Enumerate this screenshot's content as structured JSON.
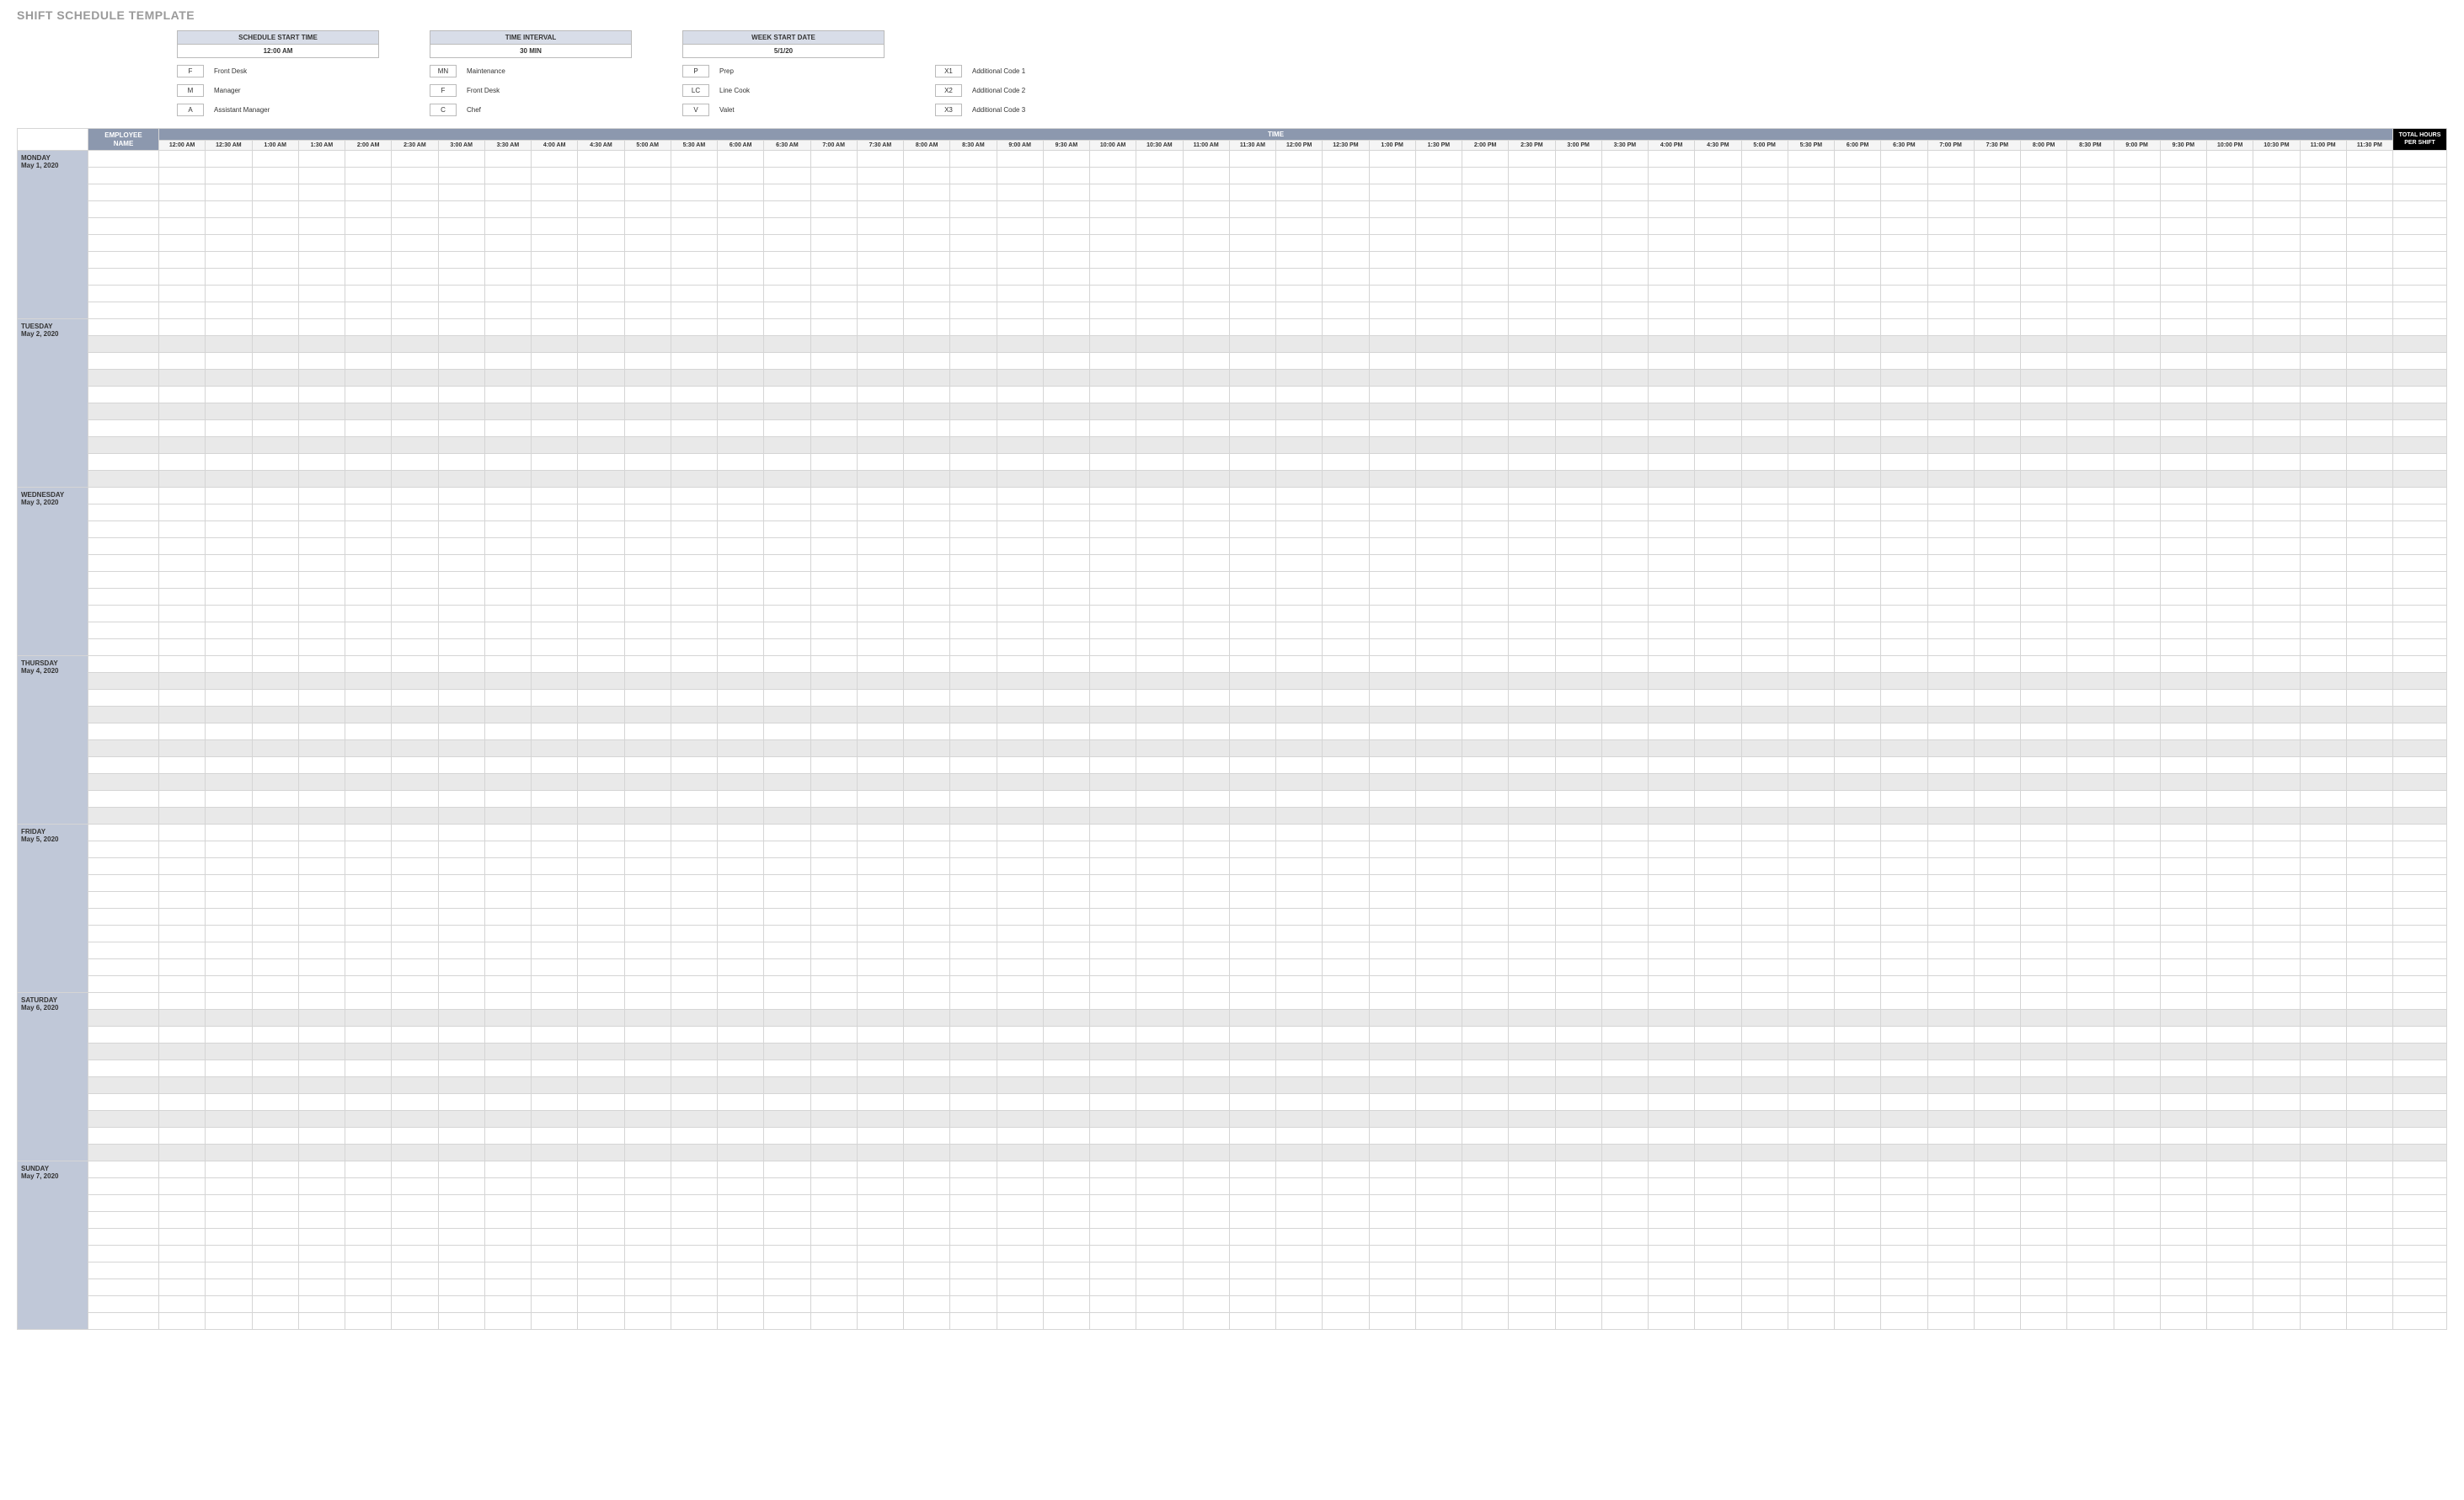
{
  "title": "SHIFT SCHEDULE TEMPLATE",
  "config": {
    "schedule_start_time": {
      "label": "SCHEDULE START TIME",
      "value": "12:00 AM"
    },
    "time_interval": {
      "label": "TIME INTERVAL",
      "value": "30 MIN"
    },
    "week_start_date": {
      "label": "WEEK START DATE",
      "value": "5/1/20"
    }
  },
  "legend": {
    "col1": [
      {
        "code": "F",
        "label": "Front Desk"
      },
      {
        "code": "M",
        "label": "Manager"
      },
      {
        "code": "A",
        "label": "Assistant Manager"
      }
    ],
    "col2": [
      {
        "code": "MN",
        "label": "Maintenance"
      },
      {
        "code": "F",
        "label": "Front Desk"
      },
      {
        "code": "C",
        "label": "Chef"
      }
    ],
    "col3": [
      {
        "code": "P",
        "label": "Prep"
      },
      {
        "code": "LC",
        "label": "Line Cook"
      },
      {
        "code": "V",
        "label": "Valet"
      }
    ],
    "col4": [
      {
        "code": "X1",
        "label": "Additional Code 1"
      },
      {
        "code": "X2",
        "label": "Additional Code 2"
      },
      {
        "code": "X3",
        "label": "Additional Code 3"
      }
    ]
  },
  "headers": {
    "time": "TIME",
    "employee_name": "EMPLOYEE NAME",
    "total_hours": "TOTAL HOURS PER SHIFT"
  },
  "time_slots": [
    "12:00 AM",
    "12:30 AM",
    "1:00 AM",
    "1:30 AM",
    "2:00 AM",
    "2:30 AM",
    "3:00 AM",
    "3:30 AM",
    "4:00 AM",
    "4:30 AM",
    "5:00 AM",
    "5:30 AM",
    "6:00 AM",
    "6:30 AM",
    "7:00 AM",
    "7:30 AM",
    "8:00 AM",
    "8:30 AM",
    "9:00 AM",
    "9:30 AM",
    "10:00 AM",
    "10:30 AM",
    "11:00 AM",
    "11:30 AM",
    "12:00 PM",
    "12:30 PM",
    "1:00 PM",
    "1:30 PM",
    "2:00 PM",
    "2:30 PM",
    "3:00 PM",
    "3:30 PM",
    "4:00 PM",
    "4:30 PM",
    "5:00 PM",
    "5:30 PM",
    "6:00 PM",
    "6:30 PM",
    "7:00 PM",
    "7:30 PM",
    "8:00 PM",
    "8:30 PM",
    "9:00 PM",
    "9:30 PM",
    "10:00 PM",
    "10:30 PM",
    "11:00 PM",
    "11:30 PM"
  ],
  "days": [
    {
      "dow": "MONDAY",
      "date": "May 1, 2020",
      "rows": 10,
      "striped": false
    },
    {
      "dow": "TUESDAY",
      "date": "May 2, 2020",
      "rows": 10,
      "striped": true
    },
    {
      "dow": "WEDNESDAY",
      "date": "May 3, 2020",
      "rows": 10,
      "striped": false
    },
    {
      "dow": "THURSDAY",
      "date": "May 4, 2020",
      "rows": 10,
      "striped": true
    },
    {
      "dow": "FRIDAY",
      "date": "May 5, 2020",
      "rows": 10,
      "striped": false
    },
    {
      "dow": "SATURDAY",
      "date": "May 6, 2020",
      "rows": 10,
      "striped": true
    },
    {
      "dow": "SUNDAY",
      "date": "May 7, 2020",
      "rows": 10,
      "striped": false
    }
  ]
}
